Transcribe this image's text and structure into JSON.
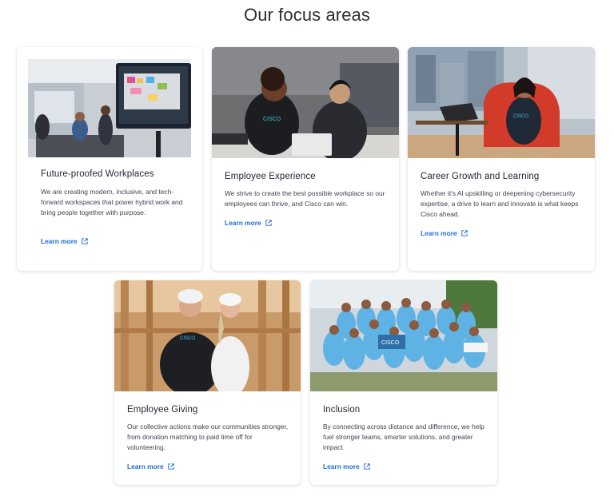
{
  "page": {
    "title": "Our focus areas"
  },
  "cards": [
    {
      "title": "Future-proofed Workplaces",
      "body": "We are creating modern, inclusive, and tech-forward workspaces that power hybrid work and bring people together with purpose.",
      "link": "Learn more",
      "image": "office-meeting-photo"
    },
    {
      "title": "Employee Experience",
      "body": "We strive to create the best possible workplace so our employees can thrive, and Cisco can win.",
      "link": "Learn more",
      "image": "employees-laptop-photo"
    },
    {
      "title": "Career Growth and Learning",
      "body": "Whether it's AI upskilling or deepening cybersecurity expertise, a drive to learn and innovate is what keeps Cisco ahead.",
      "link": "Learn more",
      "image": "employee-lounge-photo"
    },
    {
      "title": "Employee Giving",
      "body": "Our collective actions make our communities stronger, from donation matching to paid time off for volunteering.",
      "link": "Learn more",
      "image": "volunteers-construction-photo"
    },
    {
      "title": "Inclusion",
      "body": "By connecting across distance and difference, we help fuel stronger teams, smarter solutions, and greater impact.",
      "link": "Learn more",
      "image": "group-photo"
    }
  ],
  "icons": {
    "link_icon": "external-link-icon"
  },
  "colors": {
    "link": "#1e6bd6",
    "card_bg": "#ffffff",
    "title": "#2b2f36"
  }
}
